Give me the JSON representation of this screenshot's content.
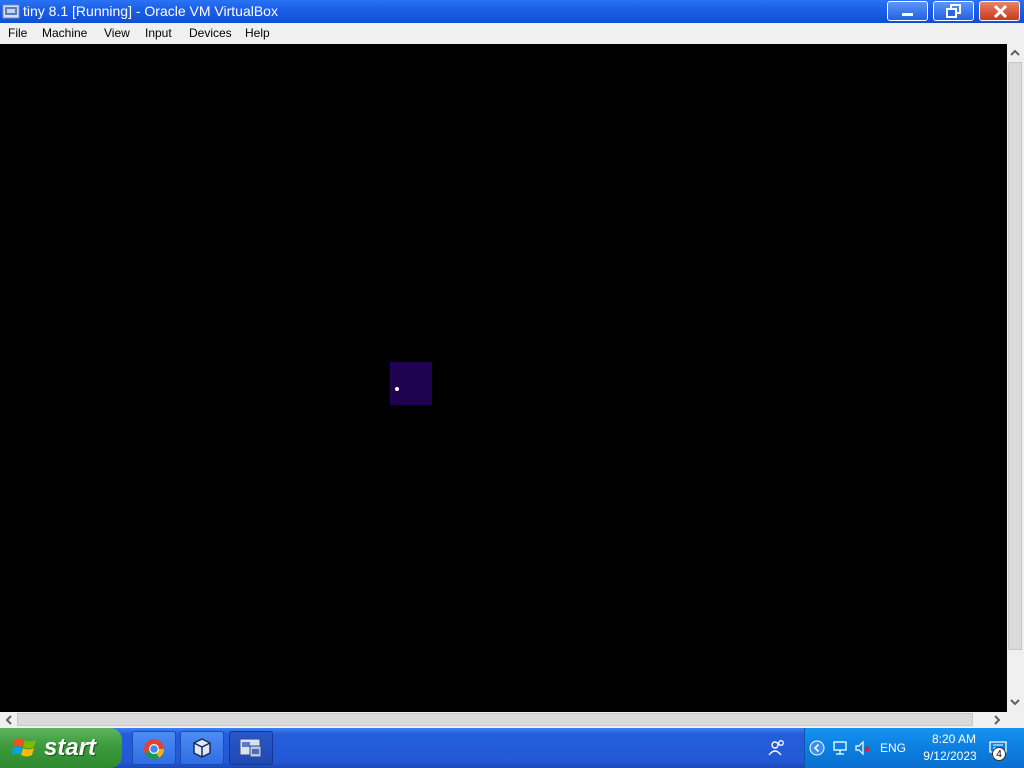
{
  "window": {
    "title": "tiny 8.1 [Running] - Oracle VM VirtualBox"
  },
  "menu": {
    "items": [
      "File",
      "Machine",
      "View",
      "Input",
      "Devices",
      "Help"
    ]
  },
  "taskbar": {
    "start_label": "start",
    "apps": [
      {
        "name": "Google Chrome",
        "icon": "chrome-icon"
      },
      {
        "name": "Oracle VM VirtualBox Manager",
        "icon": "virtualbox-icon"
      },
      {
        "name": "tiny 8.1 [Running]",
        "icon": "vm-window-icon",
        "active": true
      }
    ],
    "tray": {
      "language": "ENG",
      "time": "8:20 AM",
      "date": "9/12/2023",
      "notification_count": "4"
    }
  },
  "colors": {
    "titlebar": "#0f4fd6",
    "taskbar": "#245edb",
    "start_button": "#3c9a3c",
    "vm_square": "#1d0350"
  }
}
